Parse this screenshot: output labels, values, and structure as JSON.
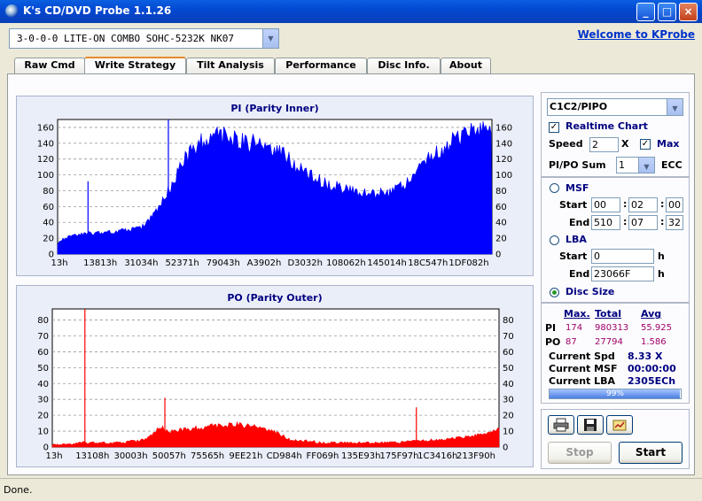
{
  "window": {
    "title": "K's CD/DVD Probe 1.1.26",
    "minimize": "_",
    "maximize": "□",
    "close": "×"
  },
  "drive": {
    "selected": "3-0-0-0 LITE-ON COMBO SOHC-5232K NK07"
  },
  "welcome_link": "Welcome to KProbe",
  "tabs": [
    {
      "label": "Raw Cmd",
      "active": false
    },
    {
      "label": "Write Strategy",
      "active": true
    },
    {
      "label": "Tilt Analysis",
      "active": false
    },
    {
      "label": "Performance",
      "active": false
    },
    {
      "label": "Disc Info.",
      "active": false
    },
    {
      "label": "About",
      "active": false
    }
  ],
  "settings": {
    "mode": "C1C2/PIPO",
    "realtime_chart": "Realtime Chart",
    "realtime_checked": true,
    "speed_label": "Speed",
    "speed_value": "2",
    "speed_unit": "X",
    "max_label": "Max",
    "max_checked": true,
    "pipo_sum_label": "PI/PO Sum",
    "pipo_sum_value": "1",
    "ecc_label": "ECC"
  },
  "range": {
    "msf_label": "MSF",
    "start_label": "Start",
    "end_label": "End",
    "msf_start": [
      "00",
      "02",
      "00"
    ],
    "msf_end": [
      "510",
      "07",
      "32"
    ],
    "lba_label": "LBA",
    "lba_start": "0",
    "lba_end": "23066F",
    "h_unit": "h",
    "disc_size_label": "Disc Size",
    "selected": "Disc Size"
  },
  "stats": {
    "headers": [
      "Max.",
      "Total",
      "Avg"
    ],
    "rows": [
      {
        "label": "PI",
        "max": "174",
        "total": "980313",
        "avg": "55.925"
      },
      {
        "label": "PO",
        "max": "87",
        "total": "27794",
        "avg": "1.586"
      }
    ],
    "current_spd_label": "Current Spd",
    "current_spd": "8.33  X",
    "current_msf_label": "Current MSF",
    "current_msf": "00:00:00",
    "current_lba_label": "Current LBA",
    "current_lba": "2305ECh",
    "progress_text": "99%",
    "progress_fraction": 0.99
  },
  "buttons": {
    "print_icon": "printer-icon",
    "save_icon": "floppy-disk-icon",
    "open_icon": "chart-open-icon",
    "stop": "Stop",
    "start": "Start"
  },
  "status": "Done.",
  "colors": {
    "pi": "#0000ff",
    "po": "#ff0000",
    "title": "#000080",
    "accent": "#0033cc"
  },
  "chart_data": [
    {
      "type": "area",
      "title": "PI (Parity Inner)",
      "x_tick_labels": [
        "13h",
        "13813h",
        "31034h",
        "52371h",
        "79043h",
        "A3902h",
        "D3032h",
        "108062h",
        "145014h",
        "18C547h",
        "1DF082h"
      ],
      "y_ticks": [
        0,
        20,
        40,
        60,
        80,
        100,
        120,
        140,
        160
      ],
      "ylim": [
        0,
        170
      ],
      "grid": true,
      "series": [
        {
          "values": [
            12,
            18,
            20,
            22,
            22,
            23,
            24,
            25,
            25,
            26,
            26,
            27,
            28,
            28,
            29,
            30,
            32,
            36,
            45,
            55,
            65,
            75,
            85,
            100,
            112,
            120,
            128,
            134,
            138,
            140,
            141,
            142,
            141,
            139,
            137,
            136,
            135,
            134,
            133,
            132,
            130,
            128,
            124,
            120,
            115,
            110,
            105,
            100,
            96,
            92,
            89,
            86,
            84,
            82,
            80,
            78,
            77,
            76,
            74,
            73,
            72,
            74,
            76,
            72,
            75,
            78,
            82,
            88,
            95,
            102,
            108,
            114,
            120,
            125,
            130,
            135,
            139,
            142,
            145,
            148,
            152,
            155,
            156,
            160
          ]
        }
      ],
      "spikes": [
        {
          "x_fraction": 0.07,
          "value": 92
        },
        {
          "x_fraction": 0.255,
          "value": 170
        }
      ]
    },
    {
      "type": "area",
      "title": "PO (Parity Outer)",
      "x_tick_labels": [
        "13h",
        "13108h",
        "30003h",
        "50057h",
        "75565h",
        "9EE21h",
        "CD984h",
        "FF069h",
        "135E93h",
        "175F97h",
        "1C3416h",
        "213F90h"
      ],
      "y_ticks": [
        0,
        10,
        20,
        30,
        40,
        50,
        60,
        70,
        80
      ],
      "ylim": [
        0,
        87
      ],
      "grid": true,
      "series": [
        {
          "values": [
            1,
            1,
            1,
            1,
            2,
            2,
            2,
            2,
            2,
            2,
            2,
            3,
            3,
            4,
            8,
            12,
            9,
            9,
            10,
            10,
            11,
            11,
            12,
            12,
            12,
            13,
            13,
            12,
            12,
            11,
            10,
            8,
            6,
            4,
            3,
            3,
            3,
            2,
            2,
            2,
            2,
            2,
            2,
            2,
            2,
            2,
            2,
            2,
            2,
            3,
            3,
            3,
            3,
            4,
            4,
            4,
            5,
            5,
            6,
            7,
            8,
            9,
            10
          ]
        }
      ],
      "spikes": [
        {
          "x_fraction": 0.073,
          "value": 87
        },
        {
          "x_fraction": 0.252,
          "value": 31
        },
        {
          "x_fraction": 0.815,
          "value": 25
        }
      ]
    }
  ]
}
